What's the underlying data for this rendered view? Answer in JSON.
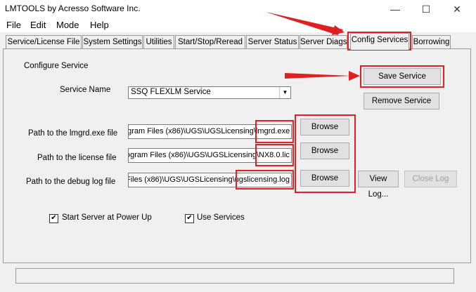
{
  "window": {
    "title": "LMTOOLS by Acresso Software Inc.",
    "minimize_glyph": "—",
    "maximize_glyph": "☐",
    "close_glyph": "✕"
  },
  "menu": [
    "File",
    "Edit",
    "Mode",
    "Help"
  ],
  "tabs": [
    "Service/License File",
    "System Settings",
    "Utilities",
    "Start/Stop/Reread",
    "Server Status",
    "Server Diags",
    "Config Services",
    "Borrowing"
  ],
  "active_tab": "Config Services",
  "config": {
    "group_label": "Configure Service",
    "service_name_label": "Service Name",
    "service_name_value": "SSQ FLEXLM Service",
    "save_button": "Save Service",
    "remove_button": "Remove Service",
    "lmgrd_label": "Path to the lmgrd.exe file",
    "lmgrd_value": "ogram Files (x86)\\UGS\\UGSLicensing\\lmgrd.exe",
    "license_label": "Path to the license file",
    "license_value": "ogram Files (x86)\\UGS\\UGSLicensing\\NX8.0.lic",
    "debug_label": "Path to the debug log file",
    "debug_value": "Files (x86)\\UGS\\UGSLicensing\\ugslicensing.log",
    "browse_label": "Browse",
    "view_log_button": "View Log...",
    "close_log_button": "Close Log",
    "start_server_label": "Start Server at Power Up",
    "start_server_checked": true,
    "use_services_label": "Use Services",
    "use_services_checked": true,
    "check_glyph": "✔"
  },
  "annotation_color": "#e02020"
}
